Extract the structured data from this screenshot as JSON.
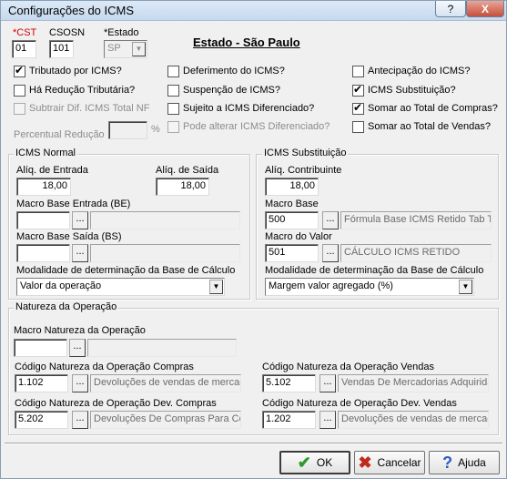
{
  "window": {
    "title": "Configurações do ICMS",
    "help_label": "?",
    "close_label": "X"
  },
  "top": {
    "cst_label": "*CST",
    "cst_value": "01",
    "csosn_label": "CSOSN",
    "csosn_value": "101",
    "estado_label": "*Estado",
    "estado_value": "SP",
    "heading": "Estado - São Paulo"
  },
  "checks": {
    "tributado": {
      "label": "Tributado por ICMS?",
      "checked": true
    },
    "reducao": {
      "label": "Há Redução Tributária?",
      "checked": false
    },
    "subtrair": {
      "label": "Subtrair Dif. ICMS Total NF",
      "checked": false
    },
    "percentual_label": "Percentual Redução",
    "percent_sign": "%",
    "diferimento": {
      "label": "Deferimento do ICMS?",
      "checked": false
    },
    "suspencao": {
      "label": "Suspenção de ICMS?",
      "checked": false
    },
    "sujeito": {
      "label": "Sujeito a ICMS Diferenciado?",
      "checked": false
    },
    "alterar": {
      "label": "Pode alterar ICMS Diferenciado?",
      "checked": false
    },
    "antecipacao": {
      "label": "Antecipação do ICMS?",
      "checked": false
    },
    "substituicao": {
      "label": "ICMS Substituição?",
      "checked": true
    },
    "somar_compras": {
      "label": "Somar ao Total de Compras?",
      "checked": true
    },
    "somar_vendas": {
      "label": "Somar ao Total de Vendas?",
      "checked": false
    }
  },
  "icms_normal": {
    "title": "ICMS Normal",
    "aliq_entrada_label": "Alíq. de Entrada",
    "aliq_entrada_value": "18,00",
    "aliq_saida_label": "Alíq. de Saída",
    "aliq_saida_value": "18,00",
    "macro_be_label": "Macro Base Entrada (BE)",
    "macro_bs_label": "Macro Base Saída (BS)",
    "modalidade_label": "Modalidade de determinação da Base de Cálculo",
    "modalidade_value": "Valor da operação"
  },
  "icms_st": {
    "title": "ICMS Substituição",
    "aliq_label": "Alíq. Contribuinte",
    "aliq_value": "18,00",
    "macro_base_label": "Macro Base",
    "macro_base_code": "500",
    "macro_base_desc": "Fórmula Base ICMS Retido Tab T",
    "macro_valor_label": "Macro do Valor",
    "macro_valor_code": "501",
    "macro_valor_desc": "CÁLCULO ICMS RETIDO",
    "modalidade_label": "Modalidade de determinação da Base de Cálculo",
    "modalidade_value": "Margem valor agregado (%)"
  },
  "natureza": {
    "title": "Natureza da Operação",
    "macro_label": "Macro Natureza da Operação",
    "compras_label": "Código Natureza da Operação Compras",
    "compras_code": "1.102",
    "compras_desc": "Devoluções de vendas de mercac",
    "vendas_label": "Código Natureza da Operação Vendas",
    "vendas_code": "5.102",
    "vendas_desc": "Vendas De Mercadorias Adquirida",
    "dev_compras_label": "Código Natureza de Operação Dev. Compras",
    "dev_compras_code": "5.202",
    "dev_compras_desc": "Devoluções De Compras Para Co",
    "dev_vendas_label": "Código Natureza de Operação Dev. Vendas",
    "dev_vendas_code": "1.202",
    "dev_vendas_desc": "Devoluções de vendas de mercac"
  },
  "buttons": {
    "ok": "OK",
    "cancelar": "Cancelar",
    "ajuda": "Ajuda",
    "dots": "..."
  },
  "colors": {
    "required": "#d00000",
    "ok_icon": "#2e9a2e",
    "cancel_icon": "#c0281a",
    "help_icon": "#2a5bc2"
  }
}
